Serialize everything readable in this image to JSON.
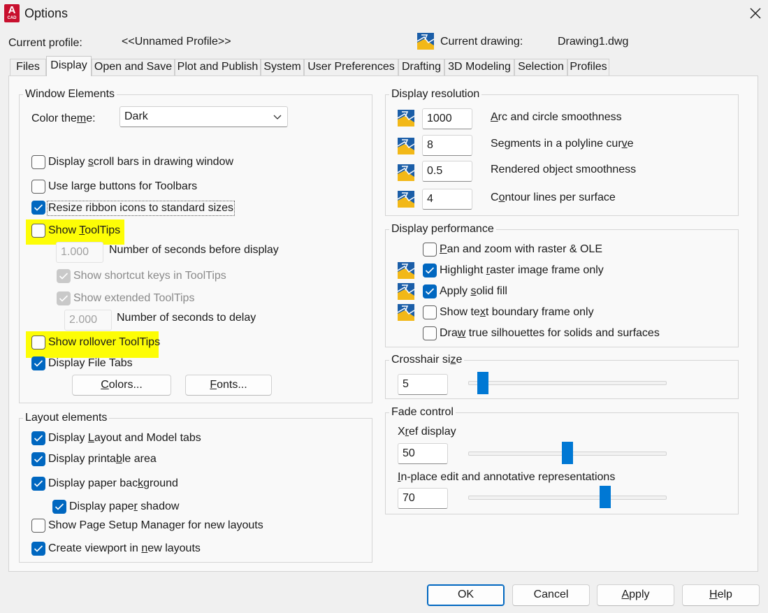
{
  "window": {
    "title": "Options"
  },
  "profile": {
    "current_profile_label": "Current profile:",
    "current_profile_value": "<<Unnamed Profile>>",
    "current_drawing_label": "Current drawing:",
    "current_drawing_value": "Drawing1.dwg"
  },
  "tabs": [
    "Files",
    "Display",
    "Open and Save",
    "Plot and Publish",
    "System",
    "User Preferences",
    "Drafting",
    "3D Modeling",
    "Selection",
    "Profiles"
  ],
  "active_tab": "Display",
  "window_elements": {
    "legend": "Window Elements",
    "color_theme_label_a": "Color the",
    "color_theme_label_u": "m",
    "color_theme_label_b": "e:",
    "color_theme_value": "Dark",
    "scroll_a": "Display ",
    "scroll_u": "s",
    "scroll_b": "croll bars in drawing window",
    "large_buttons": "Use large buttons for Toolbars",
    "resize_icons": "Resize ribbon icons to standard sizes",
    "tooltips_a": "Show ",
    "tooltips_u": "T",
    "tooltips_b": "oolTips",
    "tooltip_seconds_value": "1.000",
    "tooltip_seconds_label": "Number of seconds before display",
    "shortcut_keys": "Show shortcut keys in ToolTips",
    "extended_tooltips": "Show extended ToolTips",
    "delay_value": "2.000",
    "delay_label": "Number of seconds to delay",
    "rollover_tooltips": "Show rollover ToolTips",
    "file_tabs": "Display File Tabs",
    "colors_u": "C",
    "colors_b": "olors...",
    "fonts_u": "F",
    "fonts_b": "onts..."
  },
  "layout_elements": {
    "legend": "Layout elements",
    "layout_tabs_a": "Display ",
    "layout_tabs_u": "L",
    "layout_tabs_b": "ayout and Model tabs",
    "printable_a": "Display printa",
    "printable_u": "b",
    "printable_b": "le area",
    "paper_bg_a": "Display paper bac",
    "paper_bg_u": "k",
    "paper_bg_b": "ground",
    "paper_shadow_a": "Display pape",
    "paper_shadow_u": "r",
    "paper_shadow_b": " shadow",
    "page_setup": "Show Page Setup Manager for new layouts",
    "viewport_a": "Create viewport in ",
    "viewport_u": "n",
    "viewport_b": "ew layouts"
  },
  "display_resolution": {
    "legend": "Display resolution",
    "items": [
      {
        "value": "1000",
        "label_u": "A",
        "label_b": "rc and circle smoothness"
      },
      {
        "value": "8",
        "label_a": "Segments in a polyline cur",
        "label_u": "v",
        "label_b": "e"
      },
      {
        "value": "0.5",
        "label_a": "Rendered object smoothness"
      },
      {
        "value": "4",
        "label_a": "C",
        "label_u": "o",
        "label_b": "ntour lines per surface"
      }
    ]
  },
  "display_performance": {
    "legend": "Display performance",
    "pan_zoom_u": "P",
    "pan_zoom_b": "an and zoom with raster & OLE",
    "raster_a": "Highlight ",
    "raster_u": "r",
    "raster_b": "aster image frame only",
    "solid_fill_a": "Apply ",
    "solid_fill_u": "s",
    "solid_fill_b": "olid fill",
    "text_frame_a": "Show te",
    "text_frame_u": "x",
    "text_frame_b": "t boundary frame only",
    "silhouettes_a": "Dra",
    "silhouettes_u": "w",
    "silhouettes_b": " true silhouettes for solids and surfaces"
  },
  "crosshair": {
    "legend_a": "Crosshair si",
    "legend_u": "z",
    "legend_b": "e",
    "value": "5",
    "slider_fraction": 0.05
  },
  "fade_control": {
    "legend": "Fade control",
    "xref_a": "X",
    "xref_u": "r",
    "xref_b": "ef display",
    "xref_value": "50",
    "xref_fraction": 0.5,
    "inplace_u": "I",
    "inplace_b": "n-place edit and annotative representations",
    "inplace_value": "70",
    "inplace_fraction": 0.7
  },
  "footer": {
    "ok": "OK",
    "cancel": "Cancel",
    "apply_u": "A",
    "apply_b": "pply",
    "help_u": "H",
    "help_b": "elp"
  },
  "colors": {
    "accent": "#0067c0",
    "highlight": "#fdfd06",
    "slider_thumb": "#0078d4"
  }
}
